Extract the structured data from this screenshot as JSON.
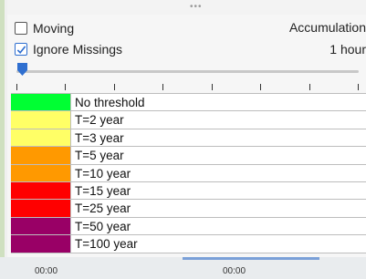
{
  "top": {
    "grip_icon": "grip-dots-icon",
    "grip_text": "•••"
  },
  "options": {
    "moving": {
      "label": "Moving",
      "checked": false
    },
    "ignore_missings": {
      "label": "Ignore Missings",
      "checked": true
    }
  },
  "accumulation": {
    "label": "Accumulation",
    "value": "1 hour"
  },
  "slider": {
    "position": 0
  },
  "legend": {
    "items": [
      {
        "label": "No threshold",
        "color": "#00ff33"
      },
      {
        "label": "T=2 year",
        "color": "#ffff66"
      },
      {
        "label": "T=3 year",
        "color": "#ffff66"
      },
      {
        "label": "T=5 year",
        "color": "#ff9900"
      },
      {
        "label": "T=10 year",
        "color": "#ff9900"
      },
      {
        "label": "T=15 year",
        "color": "#ff0000"
      },
      {
        "label": "T=25 year",
        "color": "#ff0000"
      },
      {
        "label": "T=50 year",
        "color": "#990066"
      },
      {
        "label": "T=100 year",
        "color": "#990066"
      }
    ]
  },
  "timeline": {
    "labels": [
      "00:00",
      "00:00"
    ]
  }
}
